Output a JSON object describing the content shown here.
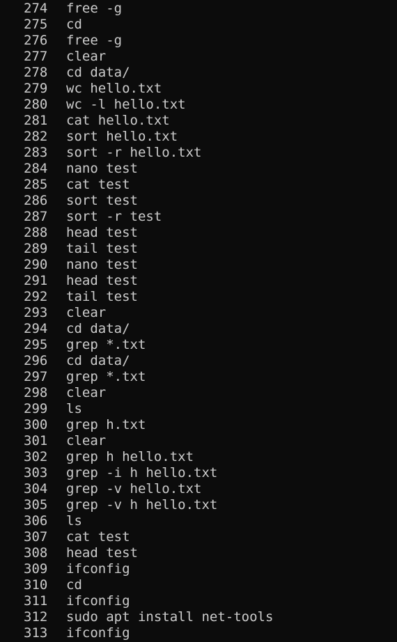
{
  "terminal": {
    "history": [
      {
        "num": "274",
        "cmd": "free -g"
      },
      {
        "num": "275",
        "cmd": "cd"
      },
      {
        "num": "276",
        "cmd": "free -g"
      },
      {
        "num": "277",
        "cmd": "clear"
      },
      {
        "num": "278",
        "cmd": "cd data/"
      },
      {
        "num": "279",
        "cmd": "wc hello.txt"
      },
      {
        "num": "280",
        "cmd": "wc -l hello.txt"
      },
      {
        "num": "281",
        "cmd": "cat hello.txt"
      },
      {
        "num": "282",
        "cmd": "sort hello.txt"
      },
      {
        "num": "283",
        "cmd": "sort -r hello.txt"
      },
      {
        "num": "284",
        "cmd": "nano test"
      },
      {
        "num": "285",
        "cmd": "cat test"
      },
      {
        "num": "286",
        "cmd": "sort test"
      },
      {
        "num": "287",
        "cmd": "sort -r test"
      },
      {
        "num": "288",
        "cmd": "head test"
      },
      {
        "num": "289",
        "cmd": "tail test"
      },
      {
        "num": "290",
        "cmd": "nano test"
      },
      {
        "num": "291",
        "cmd": "head test"
      },
      {
        "num": "292",
        "cmd": "tail test"
      },
      {
        "num": "293",
        "cmd": "clear"
      },
      {
        "num": "294",
        "cmd": "cd data/"
      },
      {
        "num": "295",
        "cmd": "grep *.txt"
      },
      {
        "num": "296",
        "cmd": "cd data/"
      },
      {
        "num": "297",
        "cmd": "grep *.txt"
      },
      {
        "num": "298",
        "cmd": "clear"
      },
      {
        "num": "299",
        "cmd": "ls"
      },
      {
        "num": "300",
        "cmd": "grep h.txt"
      },
      {
        "num": "301",
        "cmd": "clear"
      },
      {
        "num": "302",
        "cmd": "grep h hello.txt"
      },
      {
        "num": "303",
        "cmd": "grep -i h hello.txt"
      },
      {
        "num": "304",
        "cmd": "grep -v hello.txt"
      },
      {
        "num": "305",
        "cmd": "grep -v h hello.txt"
      },
      {
        "num": "306",
        "cmd": "ls"
      },
      {
        "num": "307",
        "cmd": "cat test"
      },
      {
        "num": "308",
        "cmd": "head test"
      },
      {
        "num": "309",
        "cmd": "ifconfig"
      },
      {
        "num": "310",
        "cmd": "cd"
      },
      {
        "num": "311",
        "cmd": "ifconfig"
      },
      {
        "num": "312",
        "cmd": "sudo apt install net-tools"
      },
      {
        "num": "313",
        "cmd": "ifconfig"
      }
    ]
  },
  "colors": {
    "background": "#0c0c0c",
    "foreground": "#cccccc"
  }
}
